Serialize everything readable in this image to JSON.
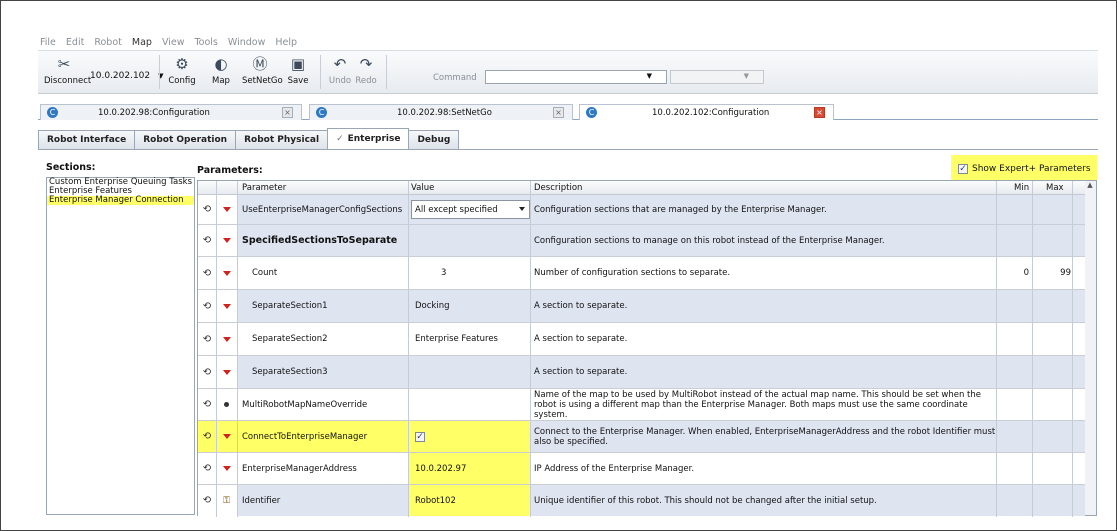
{
  "menu": [
    "File",
    "Edit",
    "Robot",
    "Map",
    "View",
    "Tools",
    "Window",
    "Help"
  ],
  "toolbar": {
    "disconnect_label": "Disconnect",
    "ip_value": "10.0.202.102",
    "config_label": "Config",
    "map_label": "Map",
    "setnetgo_label": "SetNetGo",
    "save_label": "Save",
    "undo_label": "Undo",
    "redo_label": "Redo",
    "command_label": "Command",
    "command_value": "",
    "command_arg_value": ""
  },
  "doc_tabs": [
    {
      "label": "10.0.202.98:Configuration",
      "active": false
    },
    {
      "label": "10.0.202.98:SetNetGo",
      "active": false
    },
    {
      "label": "10.0.202.102:Configuration",
      "active": true
    }
  ],
  "sub_tabs": [
    "Robot Interface",
    "Robot Operation",
    "Robot Physical",
    "Enterprise",
    "Debug"
  ],
  "active_sub_tab": "Enterprise",
  "sections": {
    "title": "Sections:",
    "items": [
      "Custom Enterprise Queuing Tasks",
      "Enterprise Features",
      "Enterprise Manager Connection"
    ],
    "selected": "Enterprise Manager Connection"
  },
  "parameters": {
    "title": "Parameters:",
    "show_expert_label": "Show Expert+ Parameters",
    "show_expert_checked": true,
    "columns": {
      "param": "Parameter",
      "value": "Value",
      "desc": "Description",
      "min": "Min",
      "max": "Max"
    },
    "rows": [
      {
        "name": "UseEnterpriseManagerConfigSections",
        "value": "All except specified",
        "desc": "Configuration sections that are managed by the Enterprise Manager.",
        "min": "",
        "max": ""
      },
      {
        "name": "SpecifiedSectionsToSeparate",
        "value": "",
        "desc": "Configuration sections to manage on this robot instead of the Enterprise Manager.",
        "min": "",
        "max": ""
      },
      {
        "name": "Count",
        "value": "3",
        "desc": "Number of configuration sections to separate.",
        "min": "0",
        "max": "99"
      },
      {
        "name": "SeparateSection1",
        "value": "Docking",
        "desc": "A section to separate.",
        "min": "",
        "max": ""
      },
      {
        "name": "SeparateSection2",
        "value": "Enterprise Features",
        "desc": "A section to separate.",
        "min": "",
        "max": ""
      },
      {
        "name": "SeparateSection3",
        "value": "",
        "desc": "A section to separate.",
        "min": "",
        "max": ""
      },
      {
        "name": "MultiRobotMapNameOverride",
        "value": "",
        "desc": "Name of the map to be used by MultiRobot instead of the actual map name. This should be set when the robot is using a different map than the Enterprise Manager. Both maps must use the same coordinate system.",
        "min": "",
        "max": ""
      },
      {
        "name": "ConnectToEnterpriseManager",
        "value": "",
        "desc": "Connect to the Enterprise Manager. When enabled, EnterpriseManagerAddress and the robot Identifier must also be specified.",
        "min": "",
        "max": ""
      },
      {
        "name": "EnterpriseManagerAddress",
        "value": "10.0.202.97",
        "desc": "IP Address of the Enterprise Manager.",
        "min": "",
        "max": ""
      },
      {
        "name": "Identifier",
        "value": "Robot102",
        "desc": "Unique identifier of this robot. This should not be changed after the initial setup.",
        "min": "",
        "max": ""
      }
    ]
  },
  "colors": {
    "highlight": "#ffff66",
    "row_alt": "#dfe4f1",
    "arrow": "#d0231d",
    "close_active": "#d94a35"
  }
}
